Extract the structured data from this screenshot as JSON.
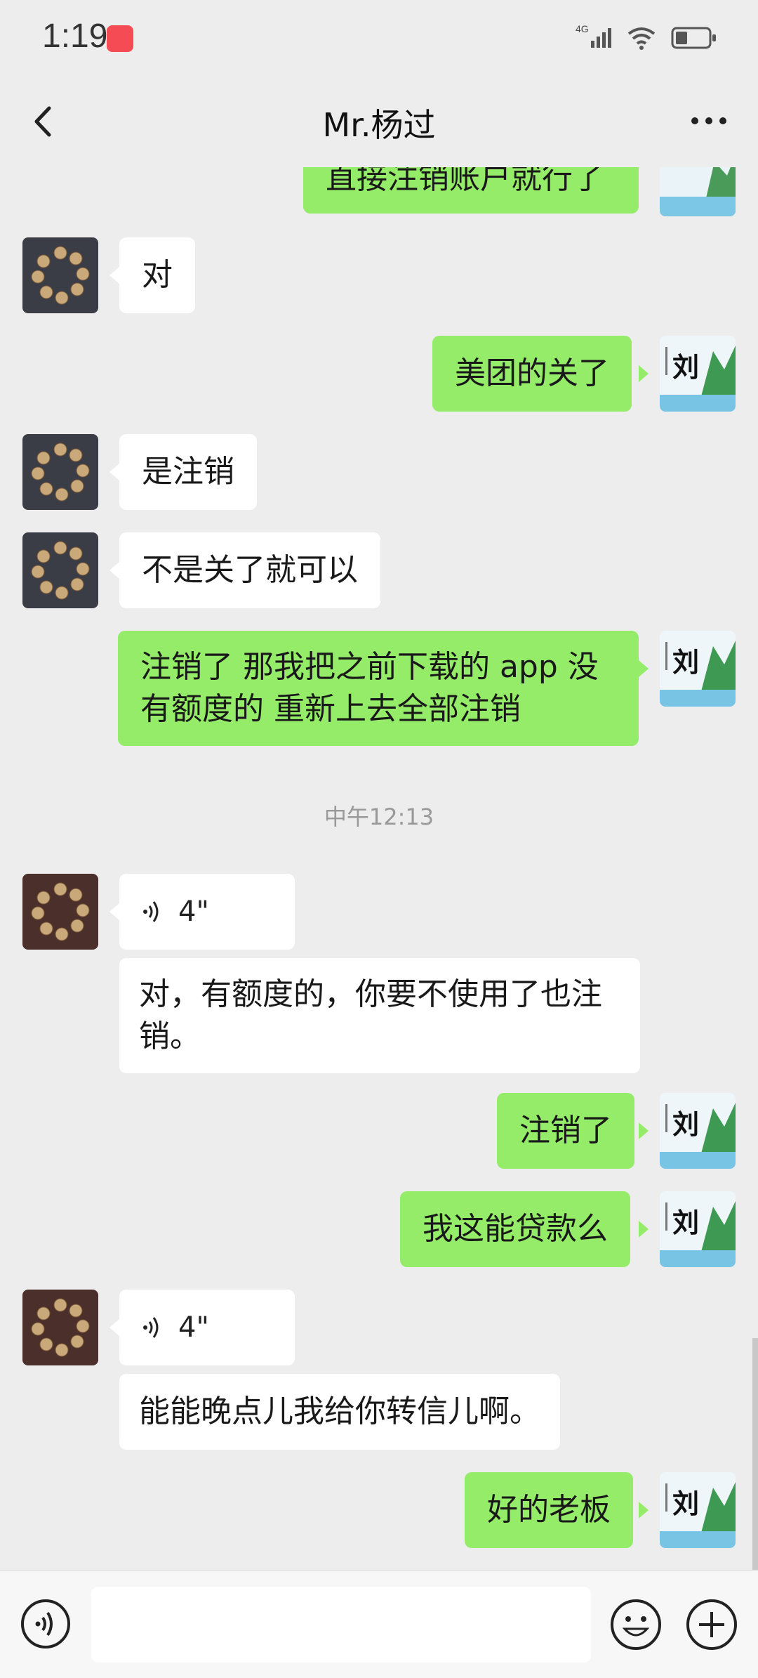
{
  "status_bar": {
    "time": "1:19",
    "network": "4G"
  },
  "header": {
    "title": "Mr.杨过"
  },
  "messages": {
    "m0": "直接注销账户就行了",
    "m1": "对",
    "m2": "美团的关了",
    "m3": "是注销",
    "m4": "不是关了就可以",
    "m5": "注销了  那我把之前下载的 app 没有额度的 重新上去全部注销",
    "time1": "中午12:13",
    "v1_duration": "4\"",
    "m6": "对，有额度的，你要不使用了也注销。",
    "m7": "注销了",
    "m8": "我这能贷款么",
    "v2_duration": "4\"",
    "m9": "能能晚点儿我给你转信儿啊。",
    "m10": "好的老板"
  },
  "avatar_text": {
    "mine_char": "刘"
  },
  "input": {
    "placeholder": ""
  },
  "colors": {
    "my_bubble": "#95ec69",
    "their_bubble": "#ffffff",
    "background": "#ededed"
  }
}
